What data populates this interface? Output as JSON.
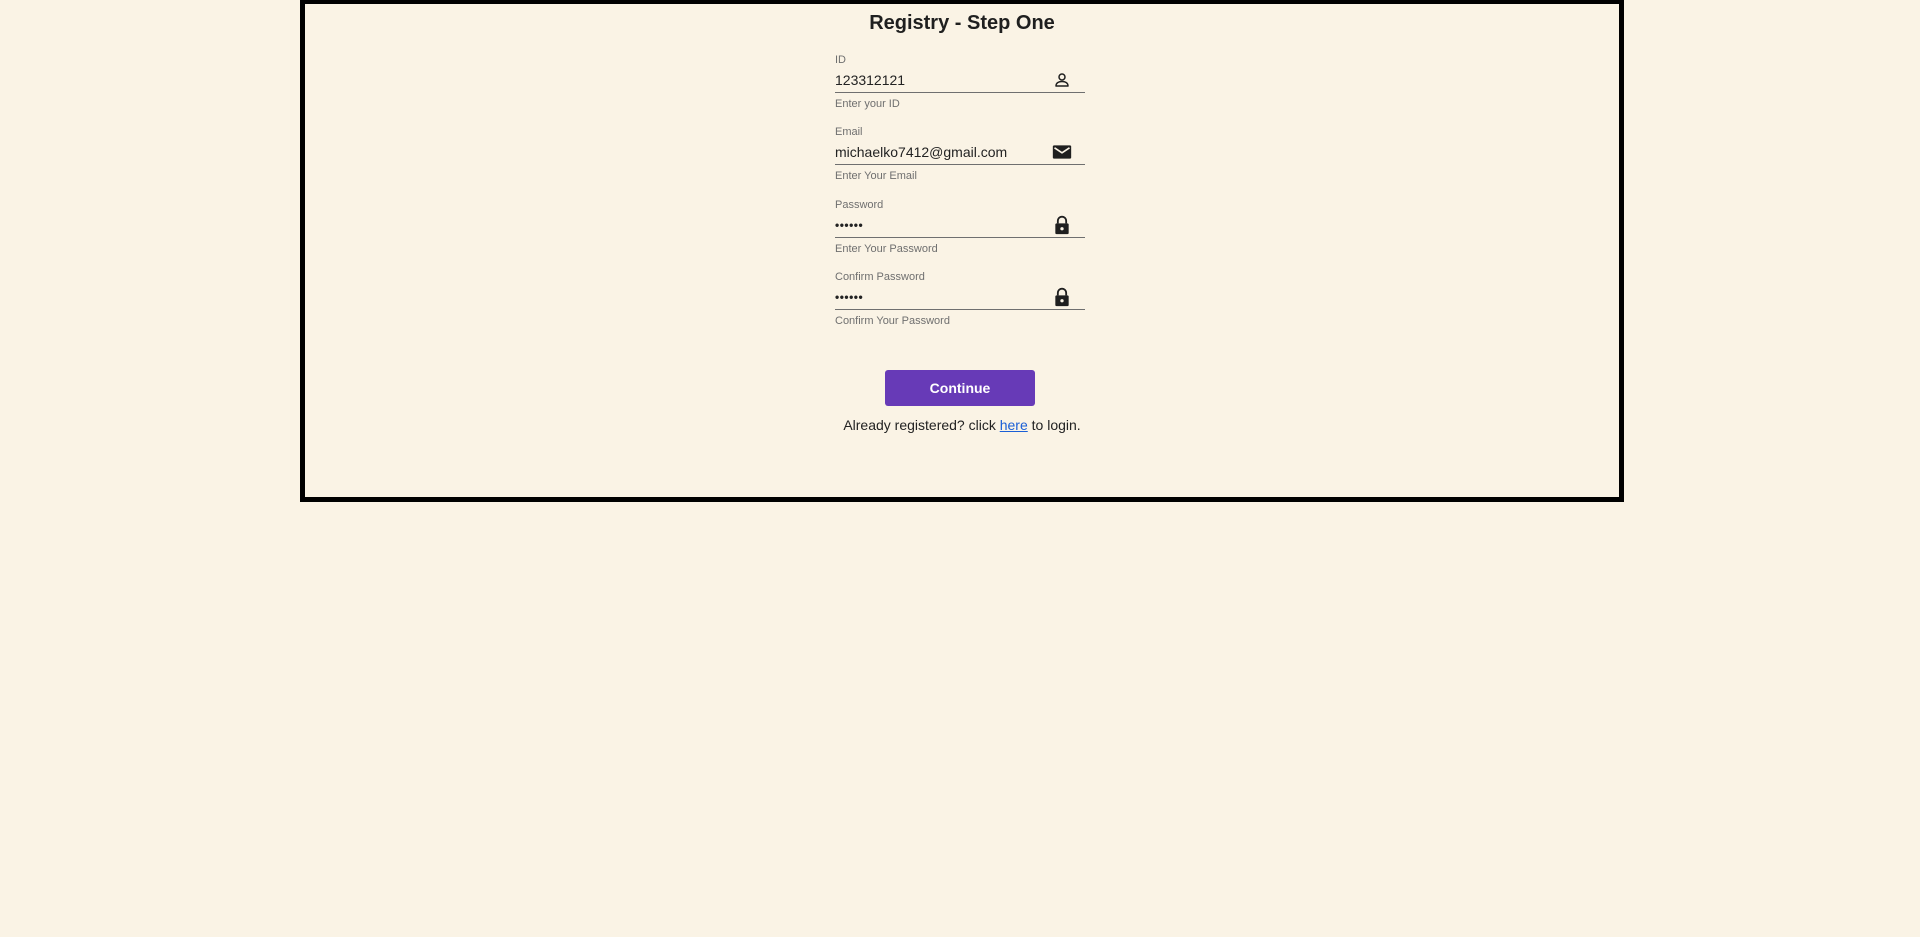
{
  "page": {
    "title": "Registry - Step One"
  },
  "form": {
    "id_field": {
      "label": "ID",
      "value": "123312121",
      "hint": "Enter your ID",
      "icon": "person-icon"
    },
    "email_field": {
      "label": "Email",
      "value": "michaelko7412@gmail.com",
      "hint": "Enter Your Email",
      "icon": "mail-icon"
    },
    "password_field": {
      "label": "Password",
      "value": "••••••",
      "hint": "Enter Your Password",
      "icon": "lock-icon"
    },
    "confirm_password_field": {
      "label": "Confirm Password",
      "value": "••••••",
      "hint": "Confirm Your Password",
      "icon": "lock-icon"
    },
    "continue_label": "Continue"
  },
  "footer": {
    "prefix": "Already registered? click",
    "link_text": "here",
    "suffix": "to login."
  },
  "colors": {
    "background": "#faf3e5",
    "accent": "#673ab7",
    "link": "#1a5fd6"
  }
}
